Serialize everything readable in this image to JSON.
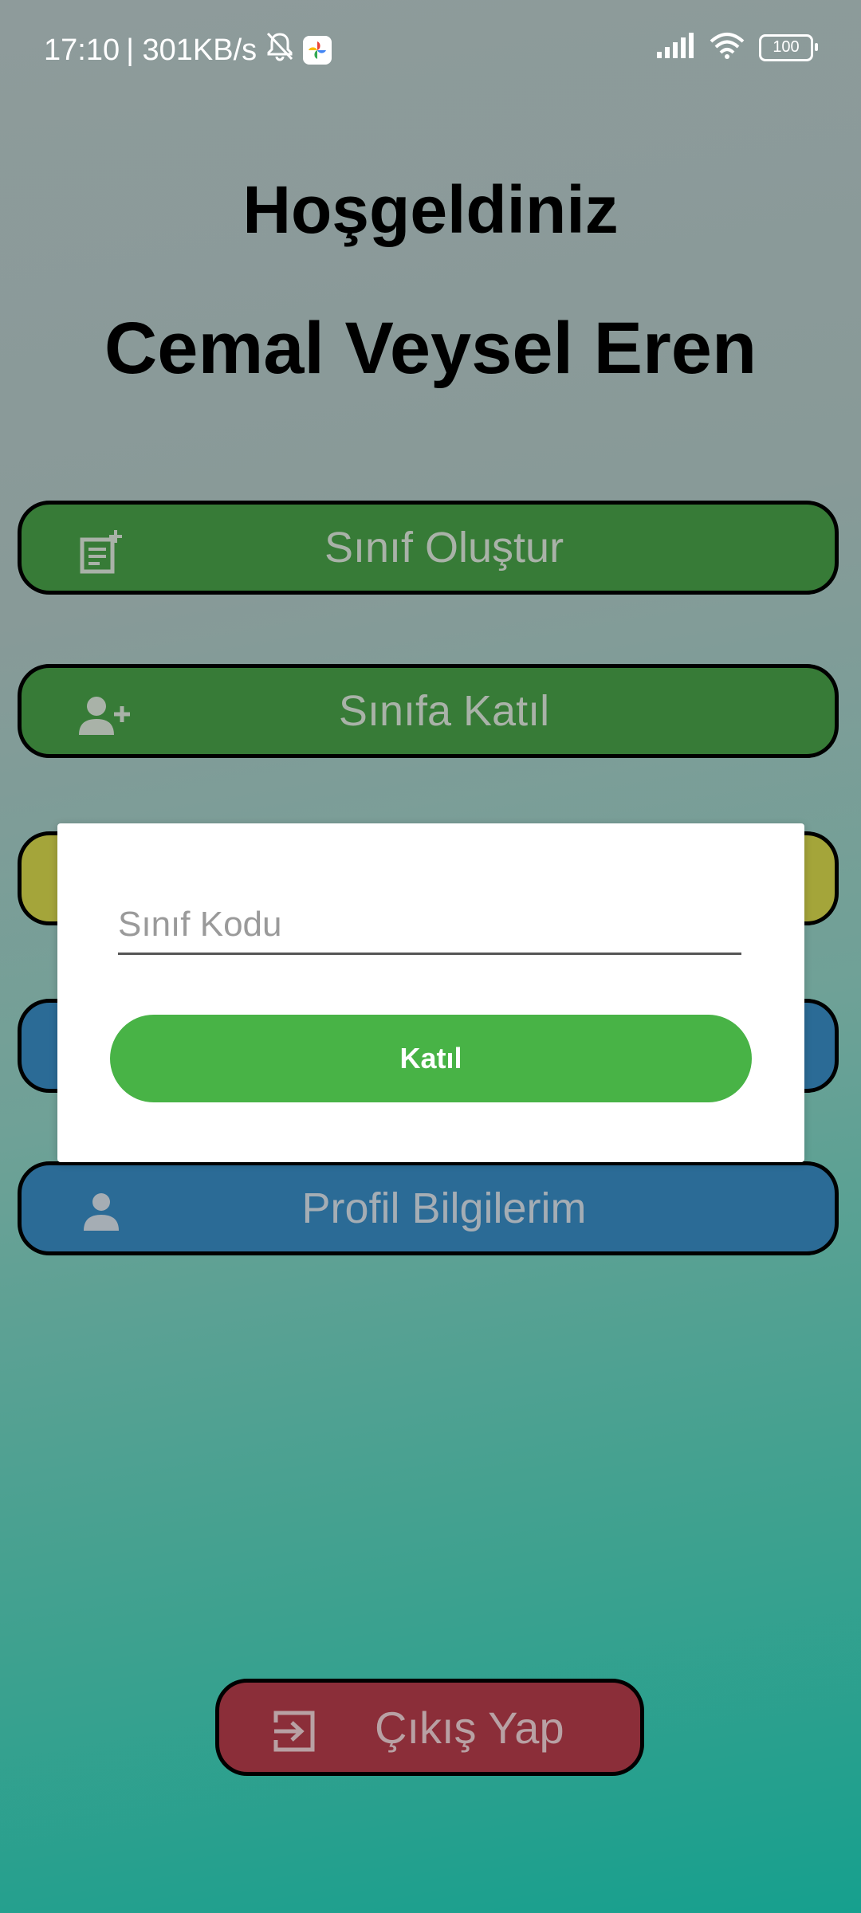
{
  "status_bar": {
    "time": "17:10",
    "net_speed": "| 301KB/s",
    "battery": "100"
  },
  "welcome": {
    "greeting": "Hoşgeldiniz",
    "user_name": "Cemal Veysel Eren"
  },
  "menu": {
    "create_class": "Sınıf Oluştur",
    "join_class": "Sınıfa Katıl",
    "profile": "Profil Bilgilerim",
    "logout": "Çıkış Yap"
  },
  "dialog": {
    "input_placeholder": "Sınıf Kodu",
    "input_value": "",
    "join_label": "Katıl"
  },
  "colors": {
    "green": "#377b37",
    "yellow": "#a4a53a",
    "blue": "#2b6b96",
    "red": "#8b2e39",
    "join": "#48b346"
  }
}
